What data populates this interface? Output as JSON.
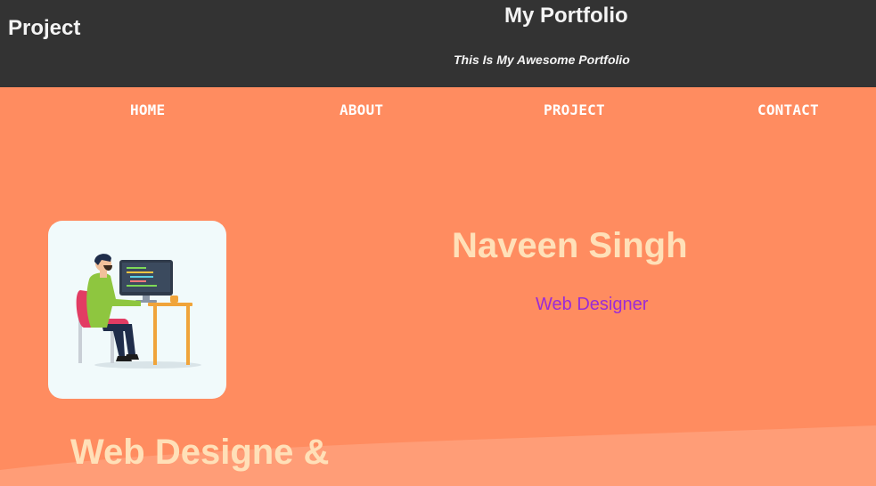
{
  "header": {
    "brand": "Project",
    "title": "My Portfolio",
    "tagline": "This Is My Awesome Portfolio"
  },
  "nav": {
    "items": [
      {
        "label": "HOME"
      },
      {
        "label": "ABOUT"
      },
      {
        "label": "PROJECT"
      },
      {
        "label": "CONTACT"
      }
    ]
  },
  "profile": {
    "name": "Naveen Singh",
    "role": "Web Designer",
    "avatar_icon": "developer-at-desk-illustration"
  },
  "section": {
    "heading": "Web Designe &"
  },
  "colors": {
    "header_bg": "#333333",
    "hero_bg": "#ff8c60",
    "name_text": "#ffe0b8",
    "role_text": "#9b2bd6",
    "nav_text": "#ffffff"
  }
}
